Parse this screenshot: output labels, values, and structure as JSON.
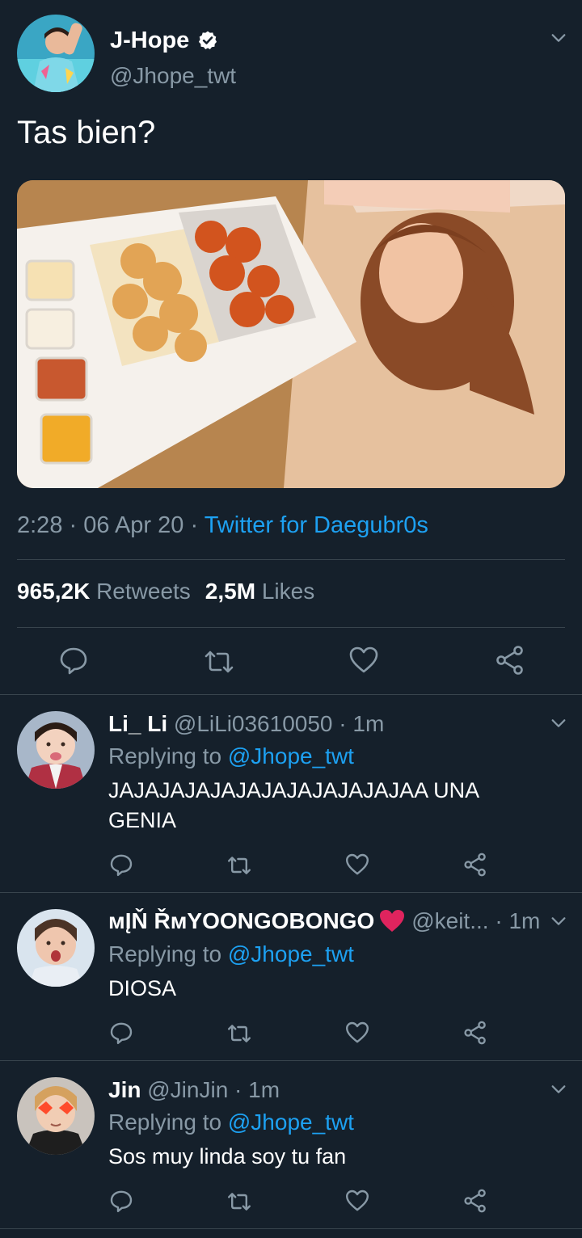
{
  "main_tweet": {
    "display_name": "J-Hope",
    "handle": "@Jhope_twt",
    "text": "Tas bien?",
    "time": "2:28",
    "date": "06 Apr 20",
    "source": "Twitter for Daegubr0s",
    "retweets_count": "965,2K",
    "retweets_label": "Retweets",
    "likes_count": "2,5M",
    "likes_label": "Likes"
  },
  "replies": [
    {
      "display_name": "Li_ Li",
      "handle": "@LiLi03610050",
      "time": "1m",
      "replying_label": "Replying to",
      "mention": "@Jhope_twt",
      "text": "JAJAJAJAJAJAJAJAJAJAJAJAA UNA GENIA"
    },
    {
      "display_name": "ᴍĮŇ ŘᴍYOONGOBONGO",
      "handle": "@keit...",
      "time": "1m",
      "replying_label": "Replying to",
      "mention": "@Jhope_twt",
      "text": "DIOSA"
    },
    {
      "display_name": "Jin",
      "handle": "@JinJin",
      "time": "1m",
      "replying_label": "Replying to",
      "mention": "@Jhope_twt",
      "text": "Sos muy linda soy tu fan"
    }
  ],
  "separator": "·",
  "colors": {
    "background": "#15202b",
    "secondary_text": "#8899a6",
    "accent": "#1da1f2",
    "divider": "#38444d"
  }
}
